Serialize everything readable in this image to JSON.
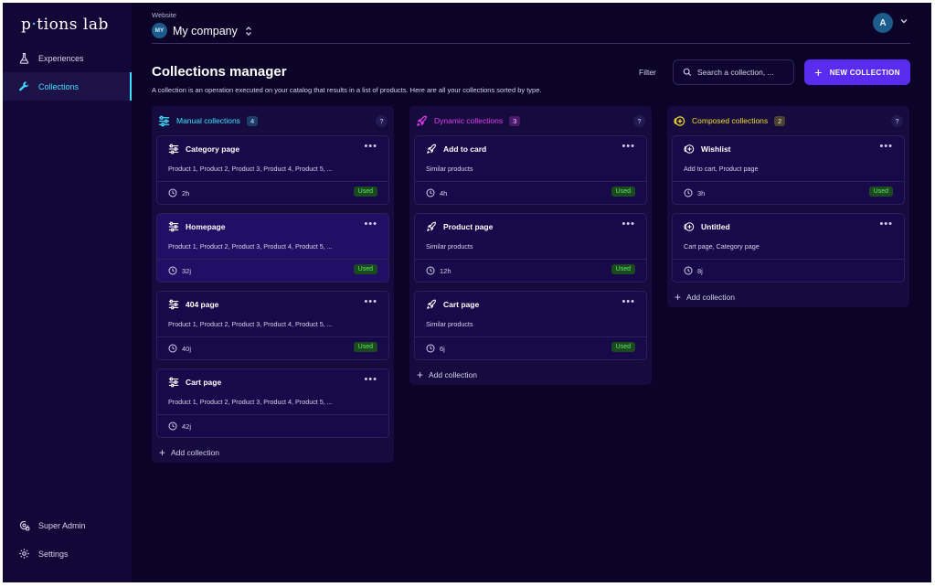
{
  "app": {
    "logo_text_before": "p",
    "logo_dot": "·",
    "logo_text_after": "tions lab"
  },
  "sidebar": {
    "items": [
      {
        "label": "Experiences",
        "icon": "flask-icon",
        "active": false
      },
      {
        "label": "Collections",
        "icon": "wrench-icon",
        "active": true
      }
    ],
    "bottom_items": [
      {
        "label": "Super Admin",
        "icon": "admin-icon"
      },
      {
        "label": "Settings",
        "icon": "gear-icon"
      }
    ]
  },
  "header": {
    "website_label": "Website",
    "workspace_initials": "MY",
    "workspace_name": "My company",
    "user_initial": "A"
  },
  "page": {
    "title": "Collections manager",
    "description": "A collection is an operation executed on your catalog that results in a list of products. Here are all your collections sorted by type.",
    "filter_label": "Filter",
    "search_placeholder": "Search a collection, ...",
    "new_button_label": "NEW COLLECTION"
  },
  "colors": {
    "manual": "#3ee0ff",
    "dynamic": "#e43cf0",
    "composed": "#f5dc28",
    "accent": "#5a2cf0"
  },
  "columns": [
    {
      "title": "Manual collections",
      "count": "4",
      "help": "?",
      "add_label": "Add collection",
      "cards": [
        {
          "title": "Category page",
          "subtitle": "Product 1, Product 2, Product 3, Product 4, Product 5, ...",
          "time": "2h",
          "badge": "Used"
        },
        {
          "title": "Homepage",
          "subtitle": "Product 1, Product 2, Product 3, Product 4, Product 5, ...",
          "time": "32j",
          "badge": "Used"
        },
        {
          "title": "404 page",
          "subtitle": "Product 1, Product 2, Product 3, Product 4, Product 5, ...",
          "time": "40j",
          "badge": "Used"
        },
        {
          "title": "Cart page",
          "subtitle": "Product 1, Product 2, Product 3, Product 4, Product 5, ...",
          "time": "42j",
          "badge": ""
        }
      ]
    },
    {
      "title": "Dynamic collections",
      "count": "3",
      "help": "?",
      "add_label": "Add collection",
      "cards": [
        {
          "title": "Add to card",
          "subtitle": "Similar products",
          "time": "4h",
          "badge": "Used"
        },
        {
          "title": "Product page",
          "subtitle": "Similar products",
          "time": "12h",
          "badge": "Used"
        },
        {
          "title": "Cart page",
          "subtitle": "Similar products",
          "time": "6j",
          "badge": "Used"
        }
      ]
    },
    {
      "title": "Composed collections",
      "count": "2",
      "help": "?",
      "add_label": "Add collection",
      "cards": [
        {
          "title": "Wishlist",
          "subtitle": "Add to cart, Product page",
          "time": "3h",
          "badge": "Used"
        },
        {
          "title": "Untitled",
          "subtitle": "Cart page, Category page",
          "time": "8j",
          "badge": ""
        }
      ]
    }
  ]
}
